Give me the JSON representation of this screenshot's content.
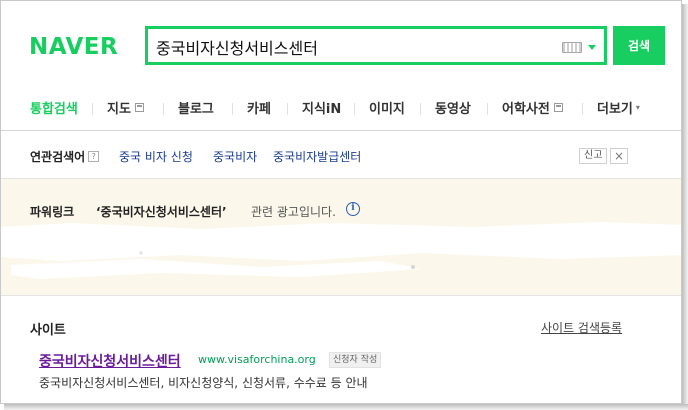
{
  "header": {
    "logo": "NAVER",
    "search_value": "중국비자신청서비스센터",
    "search_button": "검색"
  },
  "nav": {
    "items": [
      {
        "label": "통합검색",
        "active": true
      },
      {
        "label": "지도",
        "icon": "window-icon"
      },
      {
        "label": "블로그"
      },
      {
        "label": "카페"
      },
      {
        "label": "지식iN"
      },
      {
        "label": "이미지"
      },
      {
        "label": "동영상"
      },
      {
        "label": "어학사전",
        "icon": "window-icon"
      },
      {
        "label": "더보기",
        "icon": "triangle-down-icon"
      }
    ]
  },
  "related": {
    "title": "연관검색어",
    "help": "?",
    "links": [
      "중국 비자 신청",
      "중국비자",
      "중국비자발급센터"
    ],
    "report": "신고",
    "close": "×"
  },
  "powerlink": {
    "title": "파워링크",
    "query": "‘중국비자신청서비스센터’",
    "suffix": "관련 광고입니다.",
    "info": "i"
  },
  "site": {
    "title": "사이트",
    "register_link": "사이트 검색등록",
    "result": {
      "title": "중국비자신청서비스센터",
      "url": "www.visaforchina.org",
      "badge": "신청자 작성",
      "description": "중국비자신청서비스센터, 비자신청양식, 신청서류, 수수료 등 안내"
    }
  },
  "colors": {
    "brand": "#19ce60",
    "link": "#1a3d8f",
    "visited": "#6a1b9a",
    "url": "#00a05a",
    "ad_bg": "#fbf8eb"
  }
}
